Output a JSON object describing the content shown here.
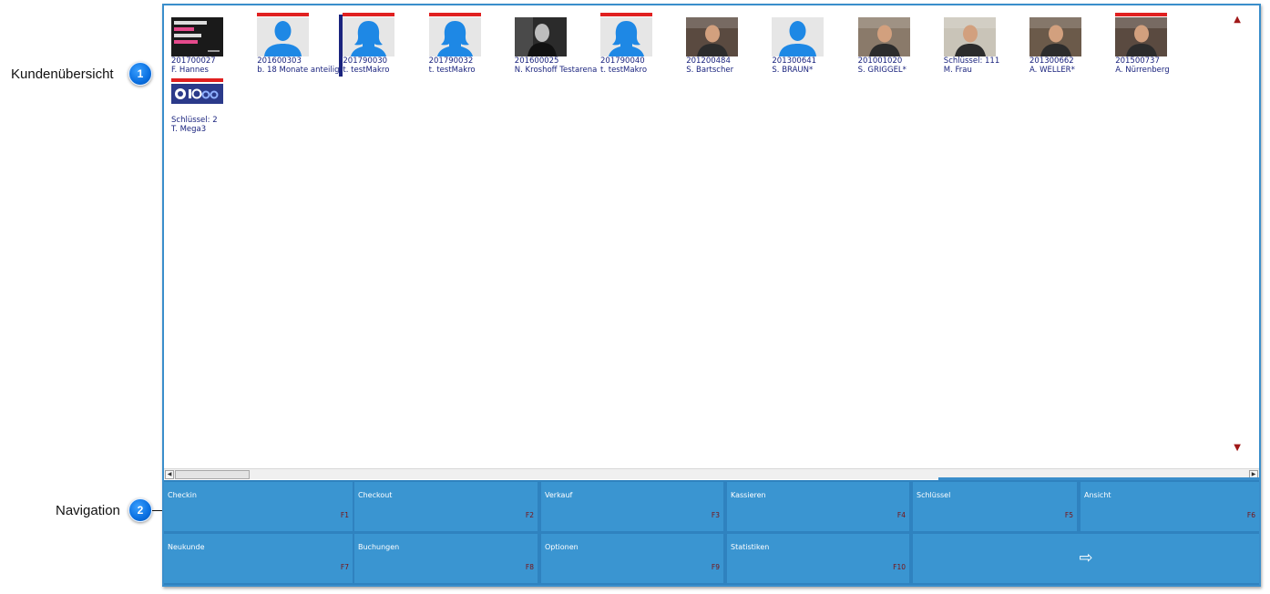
{
  "callouts": [
    {
      "label": "Kundenübersicht",
      "number": "1"
    },
    {
      "label": "Navigation",
      "number": "2"
    }
  ],
  "customers": [
    {
      "id": "201700027",
      "name": "F. Hannes",
      "flag": false,
      "photo": "text-poster-photo"
    },
    {
      "id": "201600303",
      "name": "b. 18 Monate anteilig",
      "flag": true,
      "photo": "avatar-male-icon"
    },
    {
      "id": "201790030",
      "name": "t. testMakro",
      "flag": true,
      "photo": "avatar-female-icon"
    },
    {
      "id": "201790032",
      "name": "t. testMakro",
      "flag": true,
      "photo": "avatar-female-icon"
    },
    {
      "id": "201600025",
      "name": "N. Kroshoff Testarena",
      "flag": false,
      "photo": "bw-portrait-photo"
    },
    {
      "id": "201790040",
      "name": "t. testMakro",
      "flag": true,
      "photo": "avatar-female-icon"
    },
    {
      "id": "201200484",
      "name": "S. Bartscher",
      "flag": false,
      "photo": "webcam-photo"
    },
    {
      "id": "201300641",
      "name": "S. BRAUN*",
      "flag": false,
      "photo": "avatar-male-icon"
    },
    {
      "id": "201001020",
      "name": "S. GRIGGEL*",
      "flag": false,
      "photo": "webcam-photo"
    },
    {
      "id": "Schlüssel: 111",
      "name": "M. Frau",
      "flag": false,
      "photo": "webcam-photo"
    },
    {
      "id": "201300662",
      "name": "A. WELLER*",
      "flag": false,
      "photo": "webcam-photo"
    },
    {
      "id": "201500737",
      "name": "A. Nürrenberg",
      "flag": true,
      "photo": "webcam-photo"
    },
    {
      "id": "Schlüssel: 2",
      "name": "T. Mega3",
      "flag": true,
      "photo": "logo-photo"
    }
  ],
  "nav": {
    "row1": [
      {
        "label": "Checkin",
        "key": "F1"
      },
      {
        "label": "Checkout",
        "key": "F2"
      },
      {
        "label": "Verkauf",
        "key": "F3"
      },
      {
        "label": "Kassieren",
        "key": "F4"
      },
      {
        "label": "Schlüssel",
        "key": "F5"
      },
      {
        "label": "Ansicht",
        "key": "F6"
      }
    ],
    "row2": [
      {
        "label": "Neukunde",
        "key": "F7"
      },
      {
        "label": "Buchungen",
        "key": "F8"
      },
      {
        "label": "Optionen",
        "key": "F9"
      },
      {
        "label": "Statistiken",
        "key": "F10"
      }
    ],
    "exit_icon": "⇨"
  },
  "colors": {
    "accent": "#3a95d1",
    "flag": "#e02020",
    "text": "#1a237e",
    "avatar": "#1e88e5"
  }
}
